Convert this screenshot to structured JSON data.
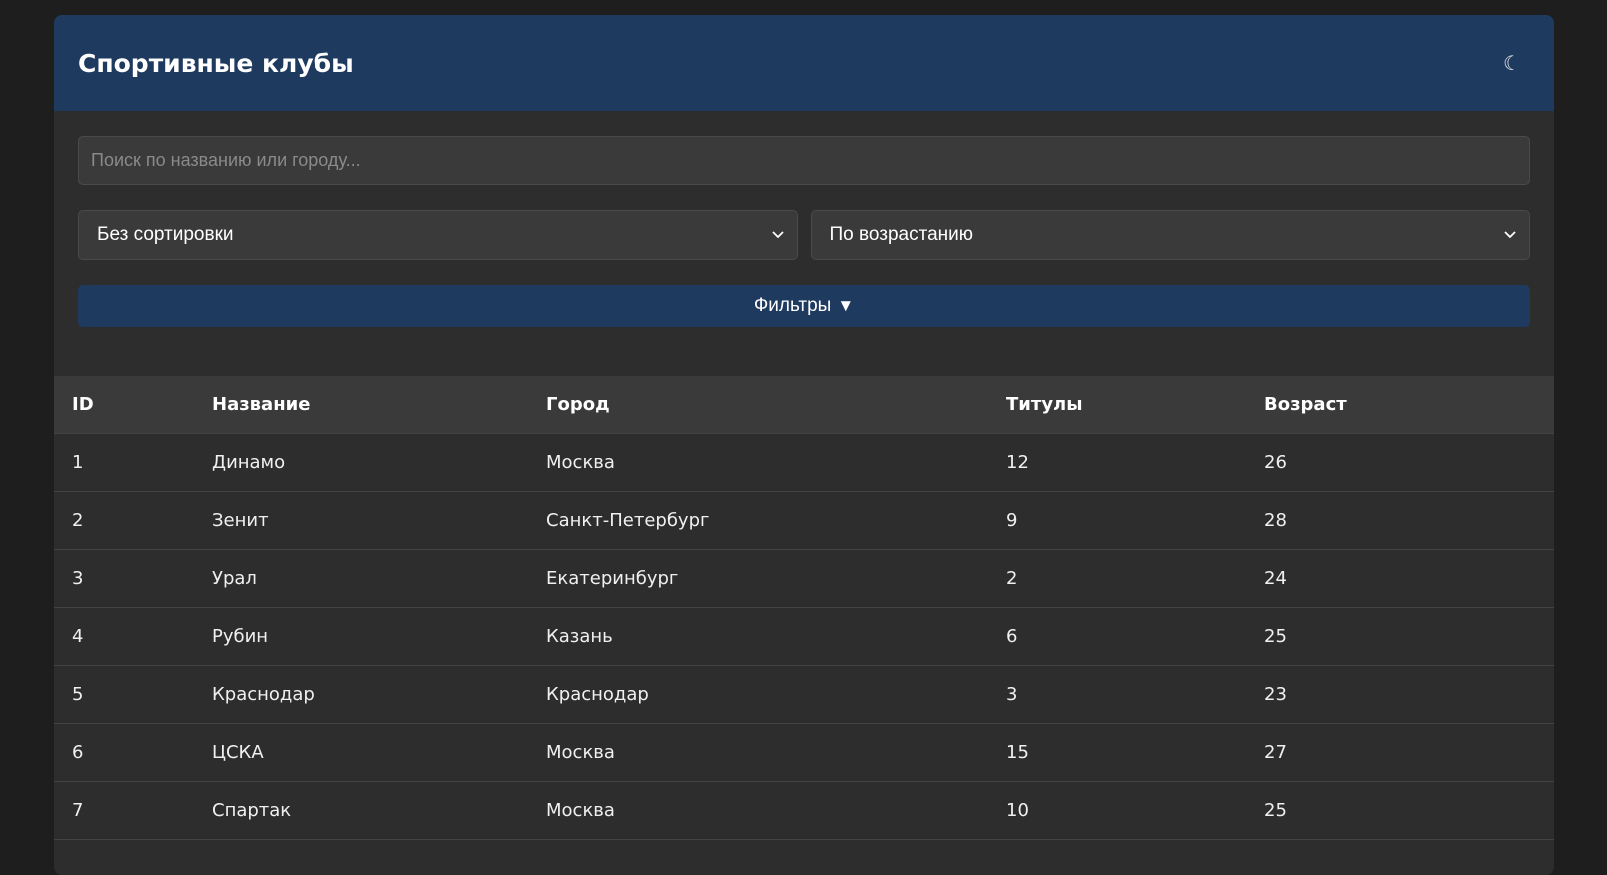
{
  "header": {
    "title": "Спортивные клубы",
    "theme_icon": "☾"
  },
  "search": {
    "placeholder": "Поиск по названию или городу...",
    "value": ""
  },
  "sort": {
    "field": "Без сортировки",
    "order": "По возрастанию"
  },
  "filters_button": {
    "label": "Фильтры",
    "arrow": "▼"
  },
  "table": {
    "columns": [
      "ID",
      "Название",
      "Город",
      "Титулы",
      "Возраст"
    ],
    "rows": [
      [
        "1",
        "Динамо",
        "Москва",
        "12",
        "26"
      ],
      [
        "2",
        "Зенит",
        "Санкт-Петербург",
        "9",
        "28"
      ],
      [
        "3",
        "Урал",
        "Екатеринбург",
        "2",
        "24"
      ],
      [
        "4",
        "Рубин",
        "Казань",
        "6",
        "25"
      ],
      [
        "5",
        "Краснодар",
        "Краснодар",
        "3",
        "23"
      ],
      [
        "6",
        "ЦСКА",
        "Москва",
        "15",
        "27"
      ],
      [
        "7",
        "Спартак",
        "Москва",
        "10",
        "25"
      ],
      [
        "",
        "",
        "",
        "",
        ""
      ]
    ]
  },
  "colors": {
    "accent": "#1e3a5f",
    "background": "#1e1e1e",
    "card": "#2d2d2d"
  }
}
